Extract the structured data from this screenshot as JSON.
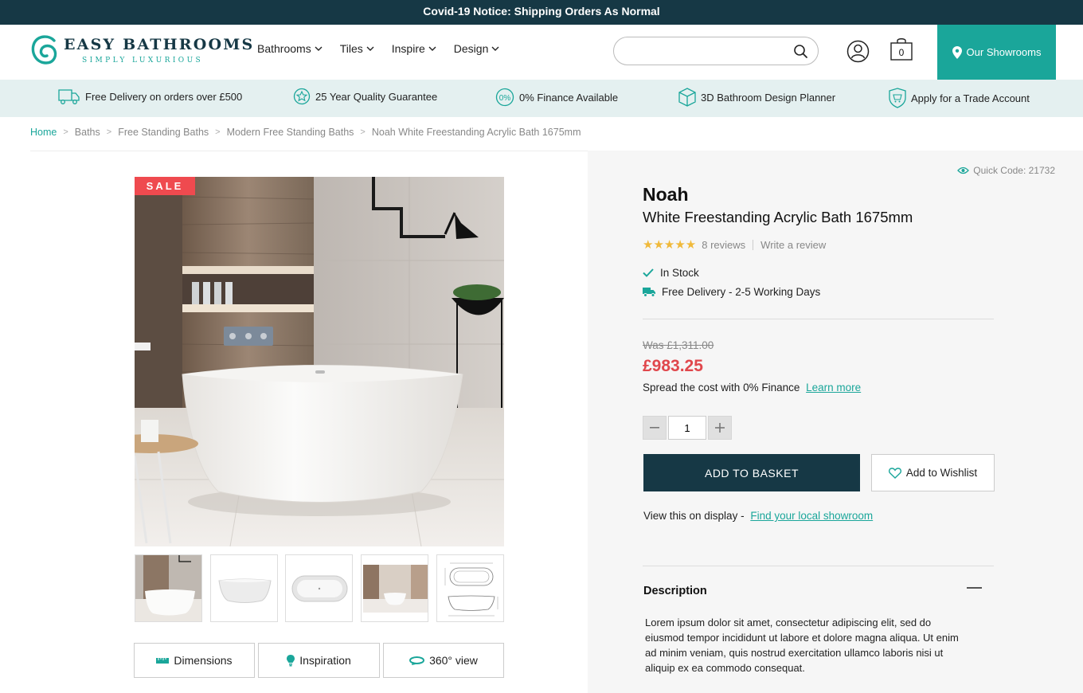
{
  "notice": {
    "text": "Covid-19 Notice: Shipping Orders As Normal"
  },
  "brand": {
    "name": "EASY BATHROOMS",
    "tagline": "SIMPLY LUXURIOUS"
  },
  "nav": [
    {
      "label": "Bathrooms"
    },
    {
      "label": "Tiles"
    },
    {
      "label": "Inspire"
    },
    {
      "label": "Design"
    }
  ],
  "search": {
    "placeholder": "",
    "icon": "search-icon"
  },
  "basket": {
    "count": "0"
  },
  "showrooms": {
    "label": "Our Showrooms",
    "icon": "map-pin-icon"
  },
  "usps": [
    {
      "label": "Free Delivery on orders over £500",
      "icon": "truck-icon"
    },
    {
      "label": "25 Year Quality Guarantee",
      "icon": "star-badge-icon"
    },
    {
      "label": "0% Finance Available",
      "icon": "percent-icon"
    },
    {
      "label": "3D Bathroom Design Planner",
      "icon": "cube-icon"
    },
    {
      "label": "Apply for a Trade Account",
      "icon": "shield-basket-icon"
    }
  ],
  "breadcrumb": [
    {
      "label": "Home"
    },
    {
      "label": "Baths"
    },
    {
      "label": "Free Standing Baths"
    },
    {
      "label": "Modern Free Standing Baths"
    },
    {
      "label": "Noah White Freestanding Acrylic Bath 1675mm"
    }
  ],
  "gallery": {
    "sale_label": "SALE",
    "media_buttons": [
      {
        "label": "Dimensions",
        "icon": "ruler-icon"
      },
      {
        "label": "Inspiration",
        "icon": "lightbulb-icon"
      },
      {
        "label": "360° view",
        "icon": "rotate-360-icon"
      }
    ]
  },
  "product": {
    "quick_code": "Quick Code: 21732",
    "name": "Noah",
    "subtitle": "White Freestanding Acrylic Bath 1675mm",
    "rating": 5,
    "stars": "★★★★★",
    "reviews": "8 reviews",
    "write_review": "Write a review",
    "stock": "In Stock",
    "delivery": "Free Delivery - 2-5 Working Days",
    "was_price": "Was £1,311.00",
    "price": "£983.25",
    "finance_text": "Spread the cost with 0% Finance",
    "finance_link": "Learn more",
    "quantity": "1",
    "add_to_basket": "ADD TO BASKET",
    "add_to_wishlist": "Add to Wishlist",
    "display_text": "View this on display -",
    "display_link": "Find your local showroom",
    "description_heading": "Description",
    "description": "Lorem ipsum dolor sit amet, consectetur adipiscing elit, sed do eiusmod tempor incididunt ut labore et dolore magna aliqua. Ut enim ad minim veniam, quis nostrud exercitation ullamco laboris nisi ut aliquip ex ea commodo consequat."
  },
  "colors": {
    "navy": "#163845",
    "teal": "#1aa69a",
    "sale_red": "#ef4a4f",
    "price_red": "#e0474c",
    "star_gold": "#f0b93a"
  }
}
